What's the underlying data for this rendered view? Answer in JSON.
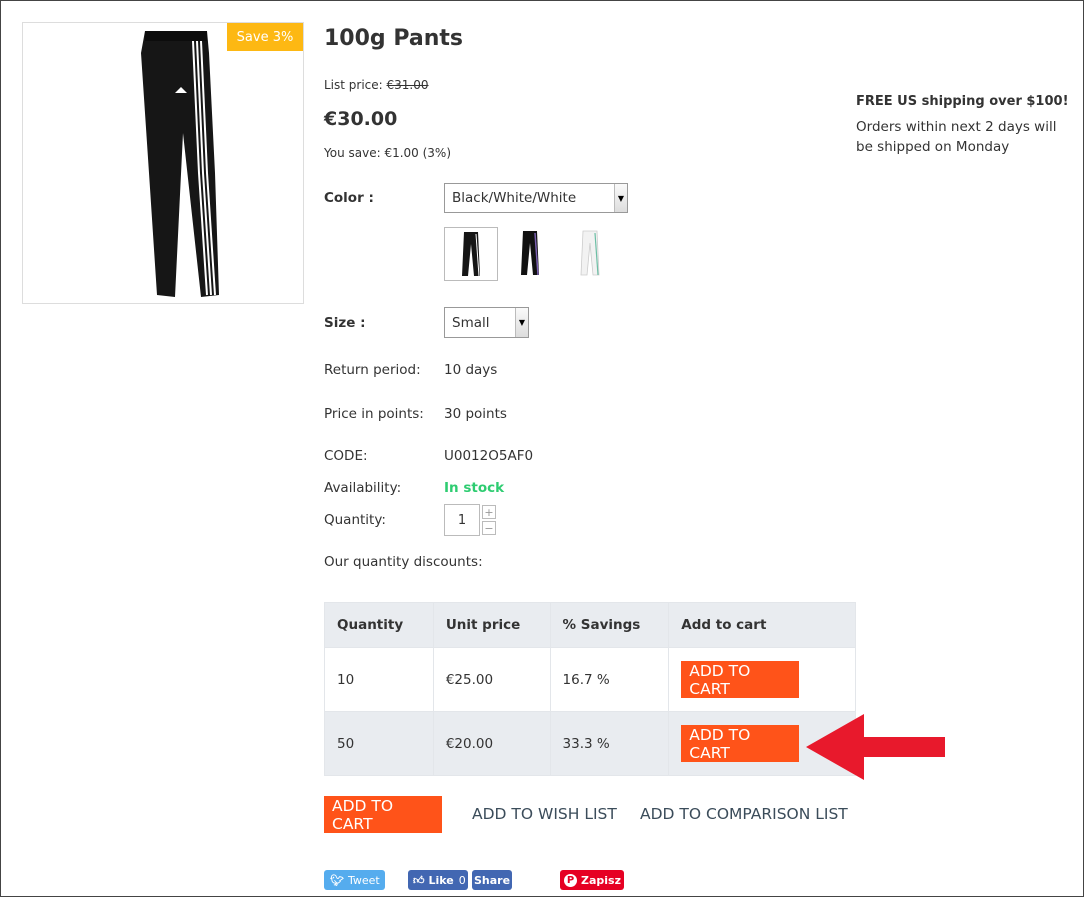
{
  "product": {
    "badge": "Save 3%",
    "title": "100g Pants",
    "list_price_label": "List price:",
    "list_price_value": "€31.00",
    "price": "€30.00",
    "you_save": "You save: €1.00 (3%)"
  },
  "shipping": {
    "title": "FREE US shipping over $100!",
    "text": "Orders within next 2 days will be shipped on Monday"
  },
  "options": {
    "color_label": "Color :",
    "color_value": "Black/White/White",
    "size_label": "Size :",
    "size_value": "Small"
  },
  "details": {
    "return_label": "Return period:",
    "return_value": "10 days",
    "points_label": "Price in points:",
    "points_value": "30 points",
    "code_label": "CODE:",
    "code_value": "U0012O5AF0",
    "availability_label": "Availability:",
    "availability_value": "In stock",
    "quantity_label": "Quantity:",
    "quantity_value": "1",
    "discounts_label": "Our quantity discounts:"
  },
  "discount_table": {
    "headers": [
      "Quantity",
      "Unit price",
      "% Savings",
      "Add to cart"
    ],
    "rows": [
      {
        "qty": "10",
        "price": "€25.00",
        "savings": "16.7 %",
        "button": "ADD TO CART"
      },
      {
        "qty": "50",
        "price": "€20.00",
        "savings": "33.3 %",
        "button": "ADD TO CART"
      }
    ]
  },
  "actions": {
    "add_to_cart": "ADD TO CART",
    "wish_list": "ADD TO WISH LIST",
    "comparison": "ADD TO COMPARISON LIST"
  },
  "social": {
    "tweet": "Tweet",
    "like": "Like",
    "like_count": "0",
    "share": "Share",
    "pin": "Zapisz"
  },
  "colors": {
    "accent": "#ff5319",
    "badge": "#fdb813",
    "in_stock": "#2ecc71",
    "annotation_arrow": "#e8192c"
  }
}
